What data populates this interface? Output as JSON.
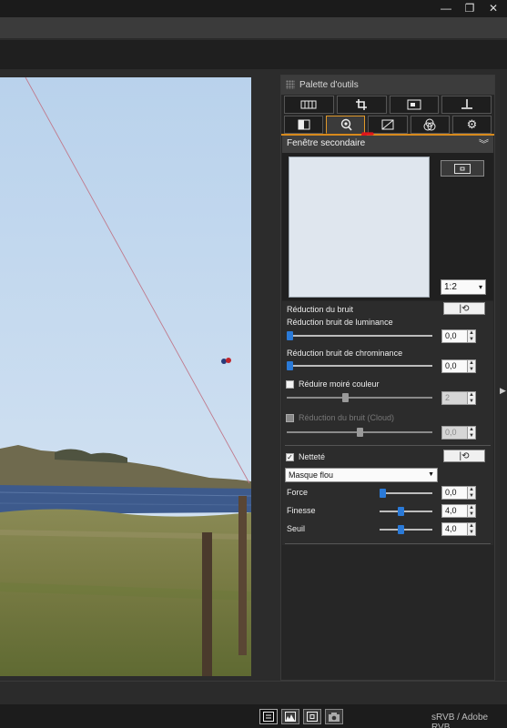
{
  "window": {
    "minimize_glyph": "—",
    "restore_glyph": "❐",
    "close_glyph": "✕"
  },
  "palette": {
    "title": "Palette d'outils",
    "tabs_top": [
      {
        "icon": "basic-adjust-icon"
      },
      {
        "icon": "crop-icon"
      },
      {
        "icon": "dust-delete-icon"
      },
      {
        "icon": "lens-correction-icon"
      }
    ],
    "tabs_bottom": [
      {
        "icon": "tone-icon"
      },
      {
        "icon": "detail-loupe-icon",
        "active": true
      },
      {
        "icon": "curve-icon"
      },
      {
        "icon": "color-icon"
      },
      {
        "icon": "settings-gear-icon"
      }
    ]
  },
  "subwindow": {
    "title": "Fenêtre secondaire",
    "zoom_value": "1:2"
  },
  "noise_reduction": {
    "title": "Réduction du bruit",
    "luminance_label": "Réduction bruit de luminance",
    "luminance_value": "0,0",
    "luminance_level": 0.0,
    "chrominance_label": "Réduction bruit de chrominance",
    "chrominance_value": "0,0",
    "chrominance_level": 0.0,
    "moire_label": "Réduire moiré couleur",
    "moire_checked": false,
    "moire_value": "2",
    "moire_level": 0.4,
    "cloud_label": "Réduction du bruit (Cloud)",
    "cloud_checked": false,
    "cloud_value": "0,0",
    "cloud_level": 0.5
  },
  "sharpness": {
    "title": "Netteté",
    "checked": true,
    "mode": "Masque flou",
    "force_label": "Force",
    "force_value": "0,0",
    "force_level": 0.0,
    "finesse_label": "Finesse",
    "finesse_value": "4,0",
    "finesse_level": 0.4,
    "seuil_label": "Seuil",
    "seuil_value": "4,0",
    "seuil_level": 0.4
  },
  "status": {
    "colorspace": "sRVB / Adobe RVB"
  },
  "colors": {
    "accent": "#d88a1c",
    "slider_thumb": "#2a7ad8",
    "annotation_arrow": "#e0151b"
  }
}
